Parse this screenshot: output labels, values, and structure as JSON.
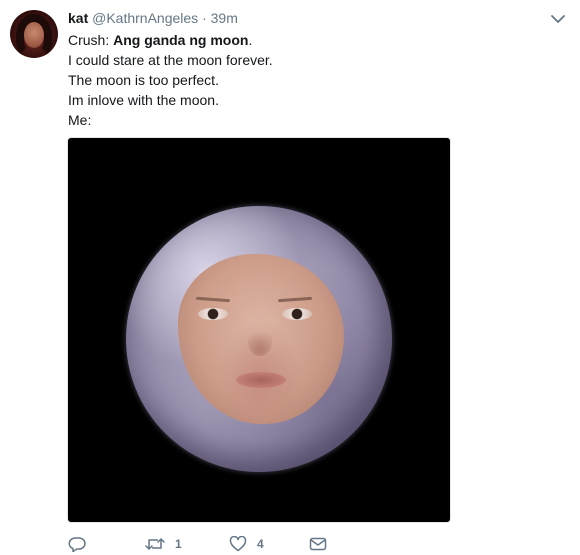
{
  "tweet": {
    "display_name": "kat",
    "handle": "@KathrnAngeles",
    "separator": "·",
    "time": "39m",
    "lines": [
      {
        "prefix": "Crush: ",
        "bold": "Ang ganda ng moon",
        "suffix": "."
      },
      {
        "text": "I could stare at the moon forever."
      },
      {
        "text": "The moon is too perfect."
      },
      {
        "text": "Im inlove with the moon."
      },
      {
        "text": "Me:"
      }
    ],
    "media_icon": "moon-face-photo"
  },
  "actions": {
    "reply_icon": "reply-icon",
    "retweet_icon": "retweet-icon",
    "retweet_count": "1",
    "like_icon": "heart-icon",
    "like_count": "4",
    "dm_icon": "envelope-icon"
  },
  "colors": {
    "text": "#14171a",
    "secondary": "#657786",
    "media_background": "#000000"
  }
}
